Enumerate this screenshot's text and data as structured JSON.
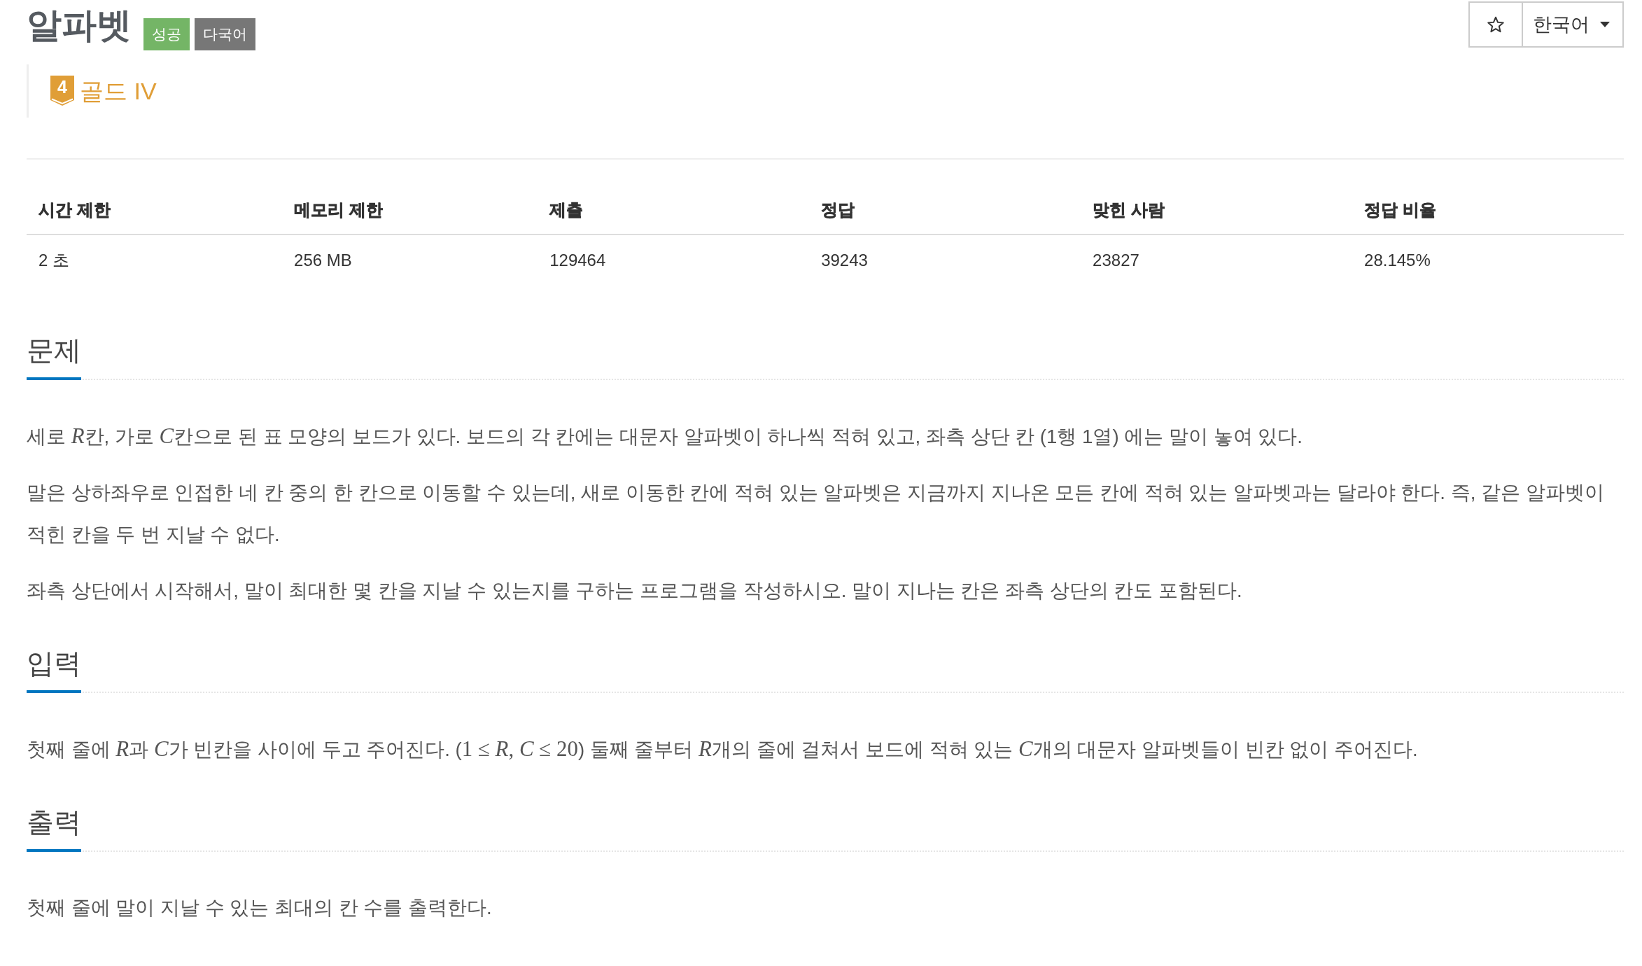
{
  "header": {
    "title": "알파벳",
    "badges": [
      {
        "label": "성공",
        "kind": "success"
      },
      {
        "label": "다국어",
        "kind": "multilang"
      }
    ]
  },
  "actions": {
    "language": "한국어"
  },
  "tier": {
    "number": "4",
    "label": "골드 IV",
    "kind": "gold"
  },
  "stats": {
    "columns": [
      "시간 제한",
      "메모리 제한",
      "제출",
      "정답",
      "맞힌 사람",
      "정답 비율"
    ],
    "rows": [
      [
        "2 초",
        "256 MB",
        "129464",
        "39243",
        "23827",
        "28.145%"
      ]
    ]
  },
  "sections": [
    {
      "heading": "문제",
      "paragraphs": [
        [
          {
            "kind": "text",
            "text": "세로 "
          },
          {
            "kind": "var",
            "text": "R"
          },
          {
            "kind": "text",
            "text": "칸, 가로 "
          },
          {
            "kind": "var",
            "text": "C"
          },
          {
            "kind": "text",
            "text": "칸으로 된 표 모양의 보드가 있다. 보드의 각 칸에는 대문자 알파벳이 하나씩 적혀 있고, 좌측 상단 칸 (1행 1열) 에는 말이 놓여 있다."
          }
        ],
        [
          {
            "kind": "text",
            "text": "말은 상하좌우로 인접한 네 칸 중의 한 칸으로 이동할 수 있는데, 새로 이동한 칸에 적혀 있는 알파벳은 지금까지 지나온 모든 칸에 적혀 있는 알파벳과는 달라야 한다. 즉, 같은 알파벳이 적힌 칸을 두 번 지날 수 없다."
          }
        ],
        [
          {
            "kind": "text",
            "text": "좌측 상단에서 시작해서, 말이 최대한 몇 칸을 지날 수 있는지를 구하는 프로그램을 작성하시오. 말이 지나는 칸은 좌측 상단의 칸도 포함된다."
          }
        ]
      ]
    },
    {
      "heading": "입력",
      "paragraphs": [
        [
          {
            "kind": "text",
            "text": "첫째 줄에 "
          },
          {
            "kind": "var",
            "text": "R"
          },
          {
            "kind": "text",
            "text": "과 "
          },
          {
            "kind": "var",
            "text": "C"
          },
          {
            "kind": "text",
            "text": "가 빈칸을 사이에 두고 주어진다. ("
          },
          {
            "kind": "num",
            "text": "1 ≤ "
          },
          {
            "kind": "var",
            "text": "R"
          },
          {
            "kind": "num",
            "text": ", "
          },
          {
            "kind": "var",
            "text": "C"
          },
          {
            "kind": "num",
            "text": " ≤ 20"
          },
          {
            "kind": "text",
            "text": ") 둘째 줄부터 "
          },
          {
            "kind": "var",
            "text": "R"
          },
          {
            "kind": "text",
            "text": "개의 줄에 걸쳐서 보드에 적혀 있는 "
          },
          {
            "kind": "var",
            "text": "C"
          },
          {
            "kind": "text",
            "text": "개의 대문자 알파벳들이 빈칸 없이 주어진다."
          }
        ]
      ]
    },
    {
      "heading": "출력",
      "paragraphs": [
        [
          {
            "kind": "text",
            "text": "첫째 줄에 말이 지날 수 있는 최대의 칸 수를 출력한다."
          }
        ]
      ]
    }
  ]
}
